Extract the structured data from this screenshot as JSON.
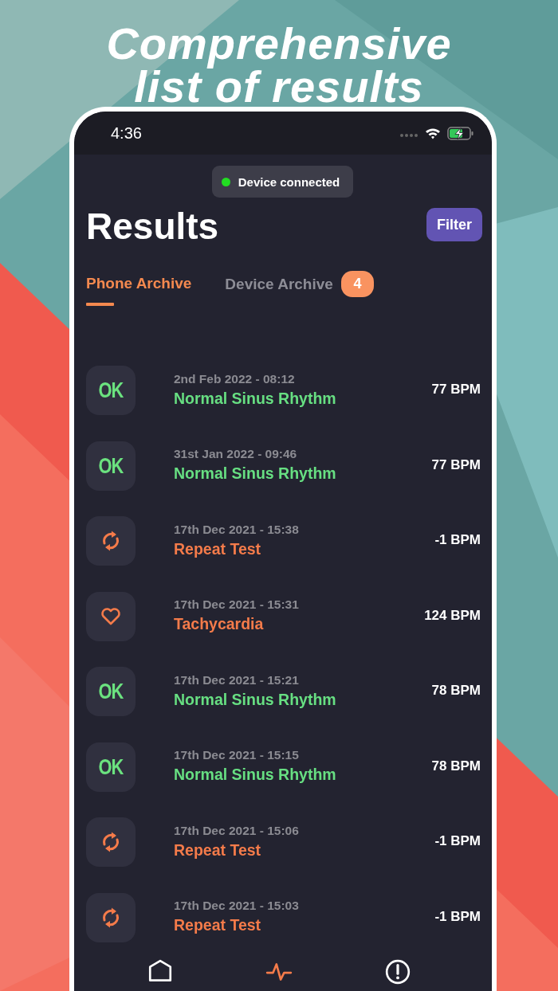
{
  "headline": [
    "Comprehensive",
    "list of results"
  ],
  "status_bar": {
    "time": "4:36"
  },
  "toast": {
    "text": "Device connected",
    "color": "#22dd22"
  },
  "title": "Results",
  "filter_button": "Filter",
  "tabs": [
    {
      "label": "Phone Archive",
      "selected": true
    },
    {
      "label": "Device Archive",
      "selected": false,
      "badge": "4"
    }
  ],
  "results": [
    {
      "kind": "ok",
      "badge": "OK",
      "date": "2nd Feb 2022 - 08:12",
      "label": "Normal Sinus Rhythm",
      "bpm": "77 BPM"
    },
    {
      "kind": "ok",
      "badge": "OK",
      "date": "31st Jan 2022 - 09:46",
      "label": "Normal Sinus Rhythm",
      "bpm": "77 BPM"
    },
    {
      "kind": "repeat",
      "date": "17th Dec 2021 - 15:38",
      "label": "Repeat Test",
      "bpm": "-1 BPM"
    },
    {
      "kind": "heart",
      "date": "17th Dec 2021 - 15:31",
      "label": "Tachycardia",
      "bpm": "124 BPM"
    },
    {
      "kind": "ok",
      "badge": "OK",
      "date": "17th Dec 2021 - 15:21",
      "label": "Normal Sinus Rhythm",
      "bpm": "78 BPM"
    },
    {
      "kind": "ok",
      "badge": "OK",
      "date": "17th Dec 2021 - 15:15",
      "label": "Normal Sinus Rhythm",
      "bpm": "78 BPM"
    },
    {
      "kind": "repeat",
      "date": "17th Dec 2021 - 15:06",
      "label": "Repeat Test",
      "bpm": "-1 BPM"
    },
    {
      "kind": "repeat",
      "date": "17th Dec 2021 - 15:03",
      "label": "Repeat Test",
      "bpm": "-1 BPM"
    }
  ],
  "nav": [
    {
      "kind": "home",
      "selected": false
    },
    {
      "kind": "pulse",
      "selected": true
    },
    {
      "kind": "alert",
      "selected": false
    }
  ]
}
